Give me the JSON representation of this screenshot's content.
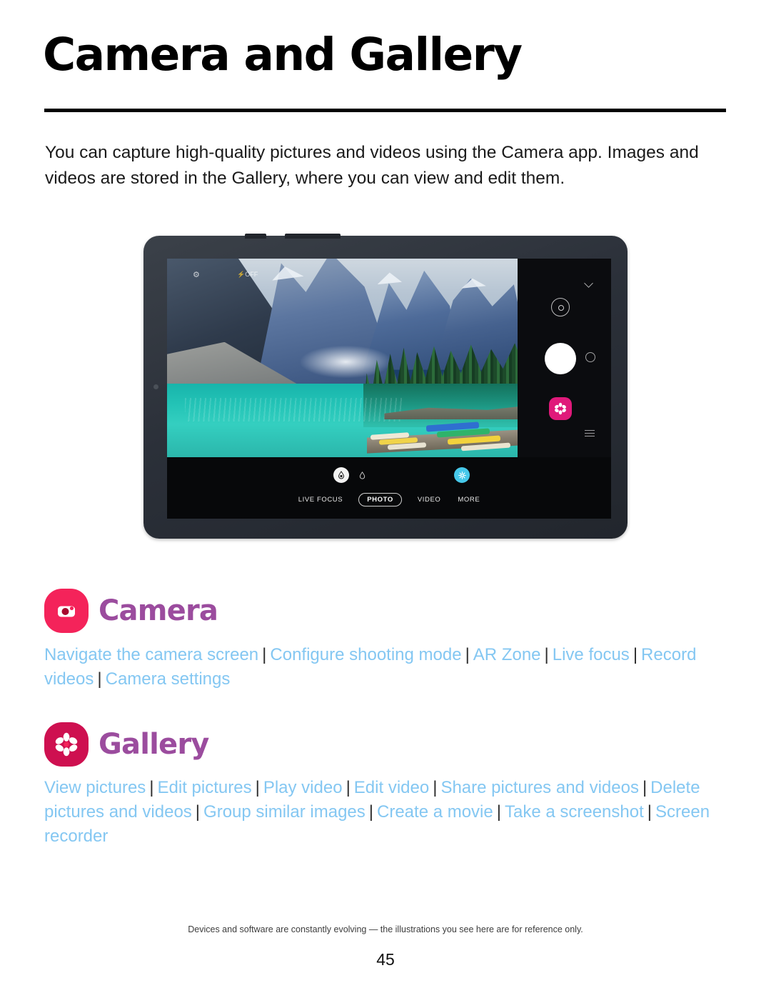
{
  "document": {
    "title": "Camera and Gallery",
    "intro": "You can capture high-quality pictures and videos using the Camera app. Images and videos are stored in the Gallery, where you can view and edit them.",
    "footnote": "Devices and software are constantly evolving — the illustrations you see here are for reference only.",
    "page_number": "45"
  },
  "colors": {
    "link_blue": "#84c7f2",
    "heading_purple": "#9b4c9e",
    "camera_icon_bg": "#f4235a",
    "gallery_icon_bg": "#ce1050",
    "separator": "#2e2e2e",
    "rule": "#000000",
    "ar_button": "#46c8ea",
    "gallery_button": "#e0197a"
  },
  "illustration": {
    "device": "samsung-galaxy-tab",
    "photo_subject": "moraine-lake-mountains-canoes",
    "viewfinder_icons": [
      "settings-icon",
      "flash-off-icon"
    ],
    "rail": {
      "chevron": "chevron-down-icon",
      "switch_camera": "switch-camera-icon",
      "shutter": "shutter-button",
      "record": "record-button",
      "gallery": "gallery-flower-icon",
      "menu": "hamburger-menu-icon"
    },
    "bottom_bar": {
      "filter_icon": "color-filter-icon",
      "filter_alt_icon": "water-drop-icon",
      "ar_icon": "ar-emoji-icon",
      "modes": [
        {
          "label": "LIVE FOCUS",
          "active": false
        },
        {
          "label": "PHOTO",
          "active": true
        },
        {
          "label": "VIDEO",
          "active": false
        },
        {
          "label": "MORE",
          "active": false
        }
      ]
    }
  },
  "sections": [
    {
      "id": "camera",
      "name": "Camera",
      "icon": "camera-app-icon",
      "links": [
        "Navigate the camera screen",
        "Configure shooting mode",
        "AR Zone",
        "Live focus",
        "Record videos",
        "Camera settings"
      ]
    },
    {
      "id": "gallery",
      "name": "Gallery",
      "icon": "gallery-app-icon",
      "links": [
        "View pictures",
        "Edit pictures",
        "Play video",
        "Edit video",
        "Share pictures and videos",
        "Delete pictures and videos",
        "Group similar images",
        "Create a movie",
        "Take a screenshot",
        "Screen recorder"
      ]
    }
  ]
}
